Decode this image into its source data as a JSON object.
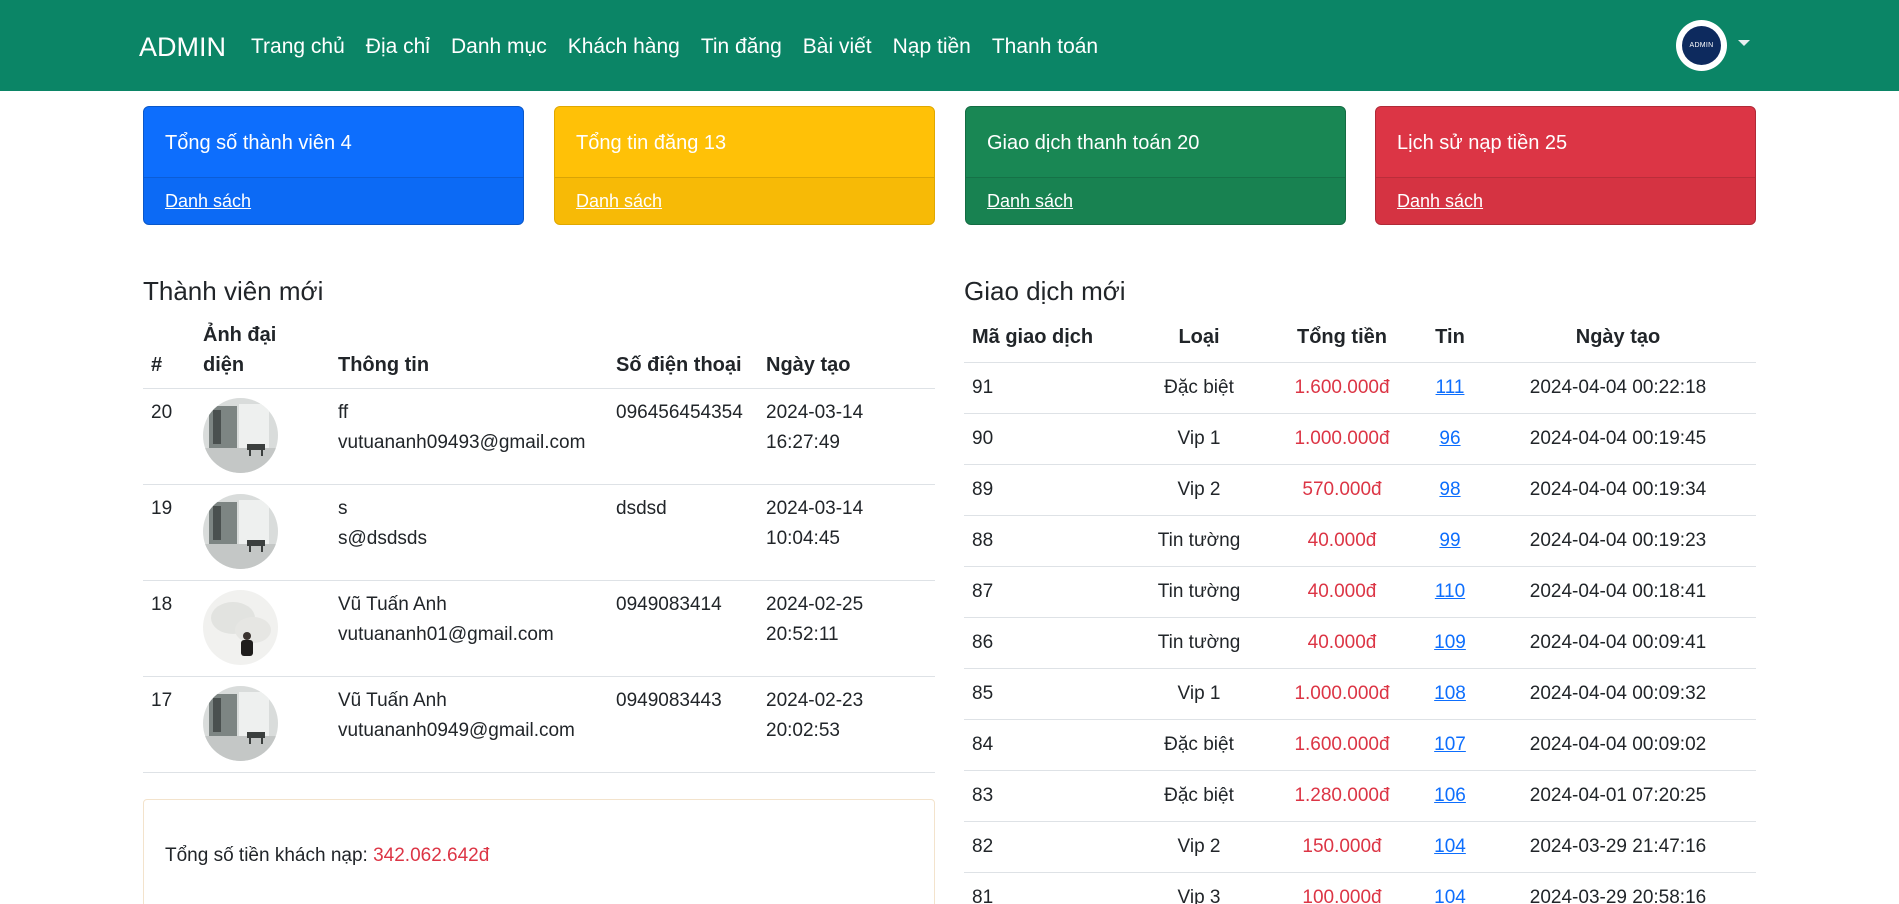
{
  "navbar": {
    "brand": "ADMIN",
    "links": [
      "Trang chủ",
      "Địa chỉ",
      "Danh mục",
      "Khách hàng",
      "Tin đăng",
      "Bài viết",
      "Nạp tiền",
      "Thanh toán"
    ],
    "avatar_text": "ADMIN"
  },
  "cards": [
    {
      "title": "Tổng số thành viên 4",
      "link": "Danh sách",
      "color": "#0d6efd"
    },
    {
      "title": "Tổng tin đăng 13",
      "link": "Danh sách",
      "color": "#ffc107"
    },
    {
      "title": "Giao dịch thanh toán 20",
      "link": "Danh sách",
      "color": "#198754"
    },
    {
      "title": "Lịch sử nạp tiền 25",
      "link": "Danh sách",
      "color": "#dc3545"
    }
  ],
  "members": {
    "title": "Thành viên mới",
    "headers": [
      "#",
      "Ảnh đại diện",
      "Thông tin",
      "Số điện thoại",
      "Ngày tạo"
    ],
    "rows": [
      {
        "id": "20",
        "name": "ff",
        "email": "vutuananh09493@gmail.com",
        "phone": "096456454354",
        "date": "2024-03-14",
        "time": "16:27:49",
        "photo": "room"
      },
      {
        "id": "19",
        "name": "s",
        "email": "s@dsdsds",
        "phone": "dsdsd",
        "date": "2024-03-14",
        "time": "10:04:45",
        "photo": "room"
      },
      {
        "id": "18",
        "name": "Vũ Tuấn Anh",
        "email": "vutuananh01@gmail.com",
        "phone": "0949083414",
        "date": "2024-02-25",
        "time": "20:52:11",
        "photo": "person"
      },
      {
        "id": "17",
        "name": "Vũ Tuấn Anh",
        "email": "vutuananh0949@gmail.com",
        "phone": "0949083443",
        "date": "2024-02-23",
        "time": "20:02:53",
        "photo": "room"
      }
    ]
  },
  "total": {
    "label": "Tổng số tiền khách nạp:",
    "value": "342.062.642đ"
  },
  "transactions": {
    "title": "Giao dịch mới",
    "headers": [
      "Mã giao dịch",
      "Loại",
      "Tổng tiền",
      "Tin",
      "Ngày tạo"
    ],
    "rows": [
      {
        "id": "91",
        "type": "Đặc biệt",
        "amount": "1.600.000đ",
        "post": "111",
        "date": "2024-04-04 00:22:18"
      },
      {
        "id": "90",
        "type": "Vip 1",
        "amount": "1.000.000đ",
        "post": "96",
        "date": "2024-04-04 00:19:45"
      },
      {
        "id": "89",
        "type": "Vip 2",
        "amount": "570.000đ",
        "post": "98",
        "date": "2024-04-04 00:19:34"
      },
      {
        "id": "88",
        "type": "Tin tường",
        "amount": "40.000đ",
        "post": "99",
        "date": "2024-04-04 00:19:23"
      },
      {
        "id": "87",
        "type": "Tin tường",
        "amount": "40.000đ",
        "post": "110",
        "date": "2024-04-04 00:18:41"
      },
      {
        "id": "86",
        "type": "Tin tường",
        "amount": "40.000đ",
        "post": "109",
        "date": "2024-04-04 00:09:41"
      },
      {
        "id": "85",
        "type": "Vip 1",
        "amount": "1.000.000đ",
        "post": "108",
        "date": "2024-04-04 00:09:32"
      },
      {
        "id": "84",
        "type": "Đặc biệt",
        "amount": "1.600.000đ",
        "post": "107",
        "date": "2024-04-04 00:09:02"
      },
      {
        "id": "83",
        "type": "Đặc biệt",
        "amount": "1.280.000đ",
        "post": "106",
        "date": "2024-04-01 07:20:25"
      },
      {
        "id": "82",
        "type": "Vip 2",
        "amount": "150.000đ",
        "post": "104",
        "date": "2024-03-29 21:47:16"
      },
      {
        "id": "81",
        "type": "Vip 3",
        "amount": "100.000đ",
        "post": "104",
        "date": "2024-03-29 20:58:16"
      }
    ]
  }
}
